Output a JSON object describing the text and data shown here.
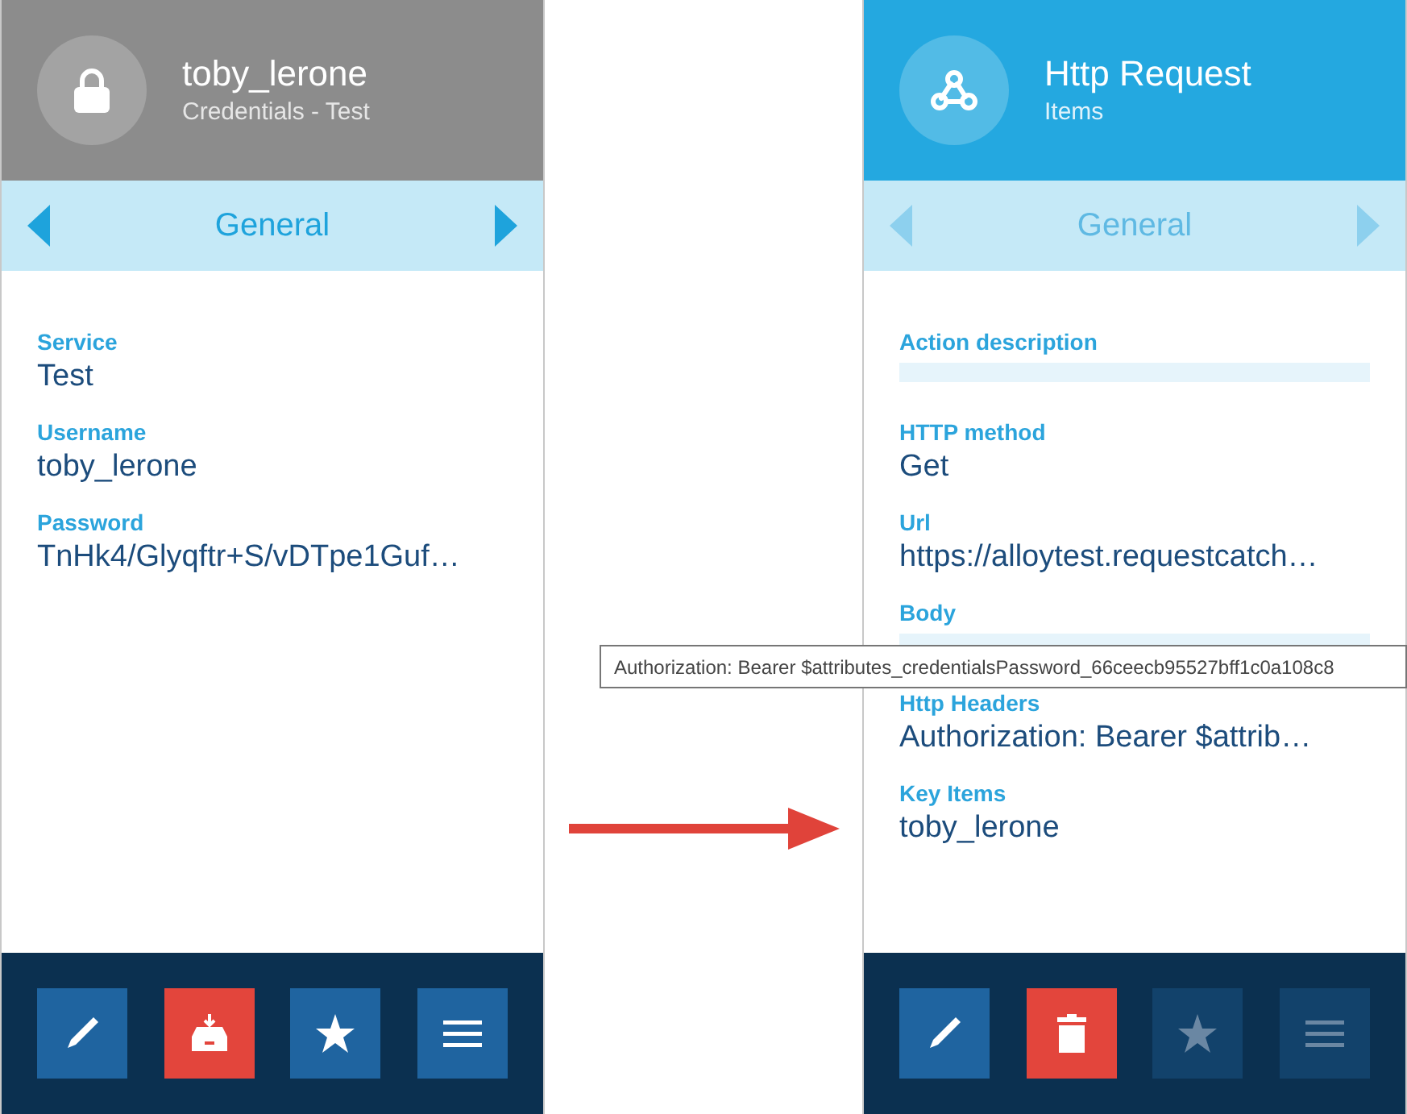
{
  "panels": [
    {
      "header": {
        "kind": "credential",
        "title": "toby_lerone",
        "subtitle": "Credentials - Test"
      },
      "nav": {
        "label": "General",
        "disabled": false
      },
      "fields": [
        {
          "kind": "text",
          "label": "Service",
          "value": "Test"
        },
        {
          "kind": "text",
          "label": "Username",
          "value": "toby_lerone"
        },
        {
          "kind": "text",
          "label": "Password",
          "value": "TnHk4/Glyqftr+S/vDTpe1Guf…"
        }
      ],
      "buttons": [
        {
          "kind": "edit",
          "disabled": false
        },
        {
          "kind": "archive",
          "disabled": false
        },
        {
          "kind": "favorite",
          "disabled": false
        },
        {
          "kind": "menu",
          "disabled": false
        }
      ]
    },
    {
      "header": {
        "kind": "request",
        "title": "Http Request",
        "subtitle": "Items"
      },
      "nav": {
        "label": "General",
        "disabled": true
      },
      "fields": [
        {
          "kind": "blank",
          "label": "Action description"
        },
        {
          "kind": "text",
          "label": "HTTP method",
          "value": "Get"
        },
        {
          "kind": "text",
          "label": "Url",
          "value": "https://alloytest.requestcatch…"
        },
        {
          "kind": "blank",
          "label": "Body"
        },
        {
          "kind": "text",
          "label": "Http Headers",
          "value": "Authorization: Bearer $attrib…"
        },
        {
          "kind": "text",
          "label": "Key Items",
          "value": "toby_lerone"
        }
      ],
      "buttons": [
        {
          "kind": "edit",
          "disabled": false
        },
        {
          "kind": "delete",
          "disabled": false
        },
        {
          "kind": "favorite",
          "disabled": true
        },
        {
          "kind": "menu",
          "disabled": true
        }
      ]
    }
  ],
  "tooltip": {
    "text": "Authorization: Bearer $attributes_credentialsPassword_66ceecb95527bff1c0a108c8"
  }
}
